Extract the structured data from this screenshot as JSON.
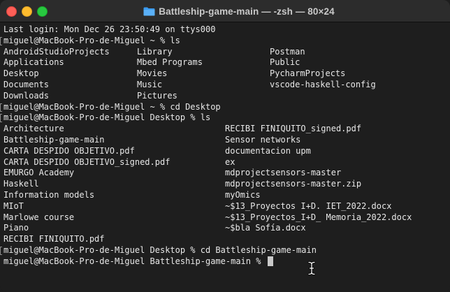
{
  "window": {
    "title": "Battleship-game-main — -zsh — 80×24",
    "colors": {
      "background": "#1e1e1e",
      "titlebar": "#2c2c2c",
      "text": "#e8e8e8",
      "close": "#fe5f57",
      "minimize": "#febc2e",
      "maximize": "#28c840",
      "folder_icon": "#3a9bf0"
    },
    "icons": {
      "close": "close-icon",
      "minimize": "minimize-icon",
      "maximize": "maximize-icon",
      "title": "folder-icon",
      "pointer": "i-beam-cursor-icon"
    }
  },
  "terminal": {
    "last_login": "Last login: Mon Dec 26 23:50:49 on ttys000",
    "cmd1": "miguel@MacBook-Pro-de-Miguel ~ % ls",
    "home_listing": [
      [
        "AndroidStudioProjects",
        "Library",
        "Postman"
      ],
      [
        "Applications",
        "Mbed Programs",
        "Public"
      ],
      [
        "Desktop",
        "Movies",
        "PycharmProjects"
      ],
      [
        "Documents",
        "Music",
        "vscode-haskell-config"
      ],
      [
        "Downloads",
        "Pictures",
        ""
      ]
    ],
    "cmd2": "miguel@MacBook-Pro-de-Miguel ~ % cd Desktop",
    "cmd3": "miguel@MacBook-Pro-de-Miguel Desktop % ls",
    "desktop_listing": [
      [
        "Architecture",
        "RECIBI FINIQUITO_signed.pdf"
      ],
      [
        "Battleship-game-main",
        "Sensor networks"
      ],
      [
        "CARTA DESPIDO OBJETIVO.pdf",
        "documentacion upm"
      ],
      [
        "CARTA DESPIDO OBJETIVO_signed.pdf",
        "ex"
      ],
      [
        "EMURGO Academy",
        "mdprojectsensors-master"
      ],
      [
        "Haskell",
        "mdprojectsensors-master.zip"
      ],
      [
        "Information models",
        "myOmics"
      ],
      [
        "MIoT",
        "~$13_Proyectos I+D. IET_2022.docx"
      ],
      [
        "Marlowe course",
        "~$13_Proyectos_I+D_ Memoria_2022.docx"
      ],
      [
        "Piano",
        "~$bla Sofía.docx"
      ],
      [
        "RECIBI FINIQUITO.pdf",
        ""
      ]
    ],
    "cmd4": "miguel@MacBook-Pro-de-Miguel Desktop % cd Battleship-game-main",
    "prompt": "miguel@MacBook-Pro-de-Miguel Battleship-game-main % "
  }
}
